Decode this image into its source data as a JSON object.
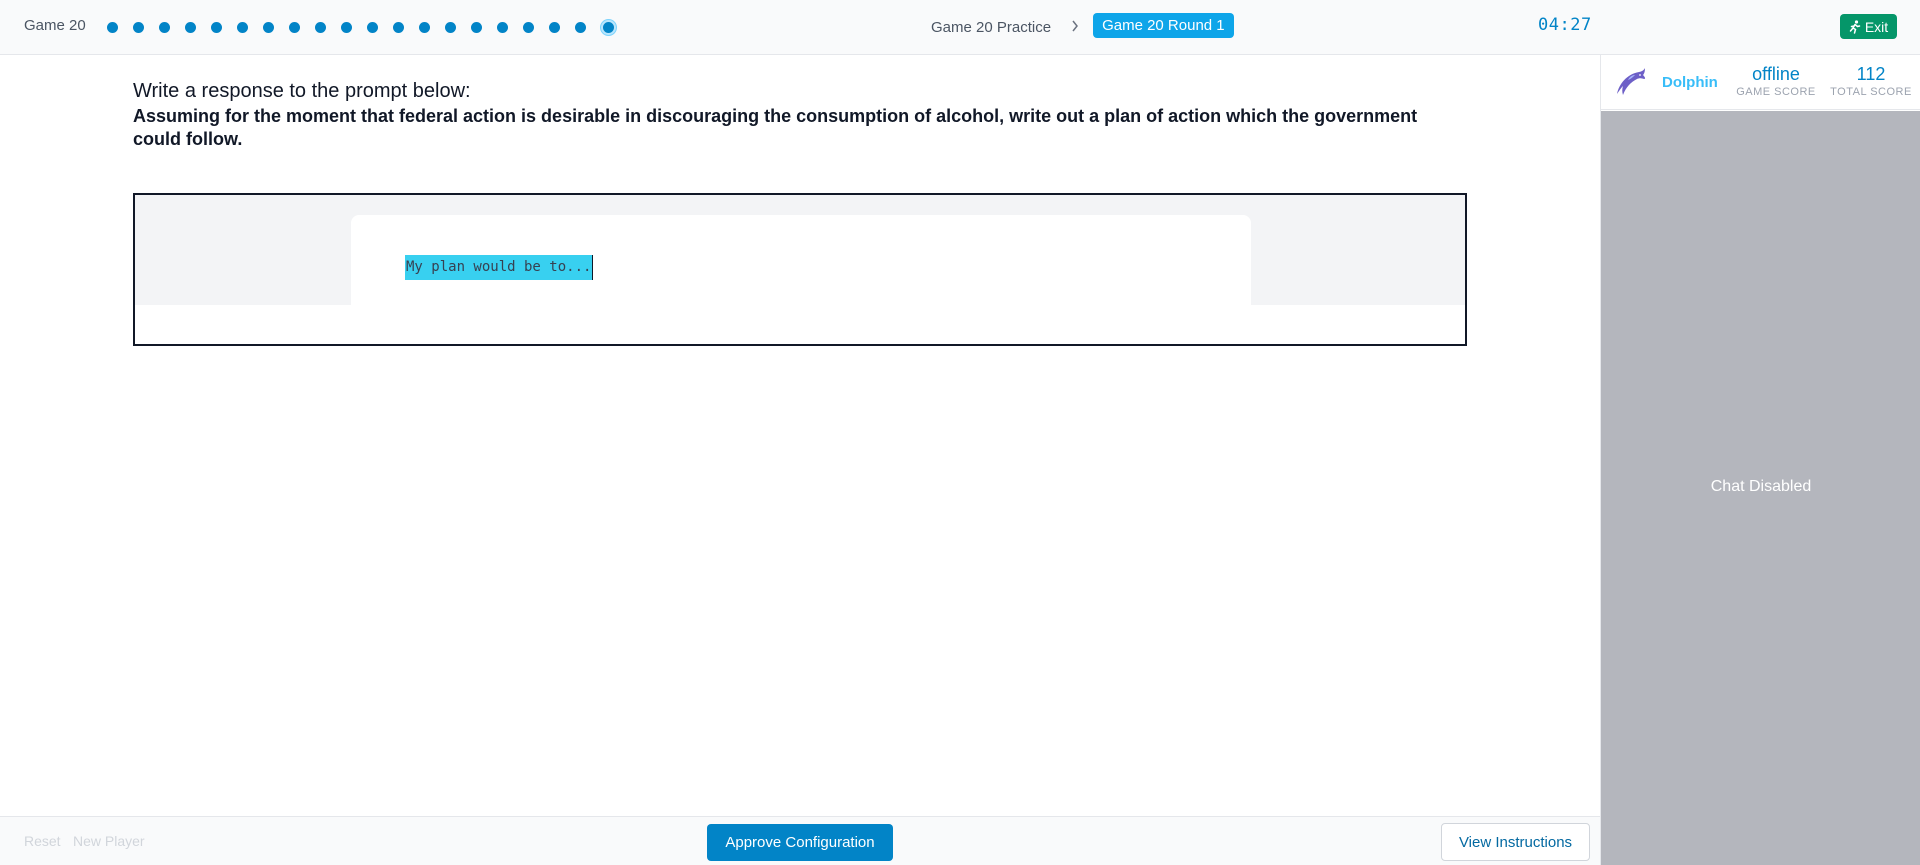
{
  "header": {
    "game_name": "Game 20",
    "progress": {
      "total_stages": 20,
      "current_stage": 20
    },
    "breadcrumb": {
      "previous": "Game 20 Practice",
      "current": "Game 20 Round 1"
    },
    "timer": "04:27",
    "exit_label": "Exit"
  },
  "main": {
    "prompt_intro": "Write a response to the prompt below:",
    "prompt_text": "Assuming for the moment that federal action is desirable in discouraging the consumption of alcohol, write out a plan of action which the government could follow.",
    "response_value": "My plan would be to..."
  },
  "footer": {
    "reset_label": "Reset",
    "new_player_label": "New Player",
    "approve_label": "Approve Configuration",
    "instructions_label": "View Instructions"
  },
  "side": {
    "player_name": "Dolphin",
    "player_icon": "dolphin-icon",
    "game_score": "offline",
    "game_score_label": "GAME SCORE",
    "total_score": "112",
    "total_score_label": "TOTAL SCORE",
    "chat_status": "Chat Disabled"
  },
  "colors": {
    "accent": "#0284c7",
    "exit": "#059669",
    "highlight": "#38d0f0",
    "chat_bg": "#b4b6bd"
  }
}
